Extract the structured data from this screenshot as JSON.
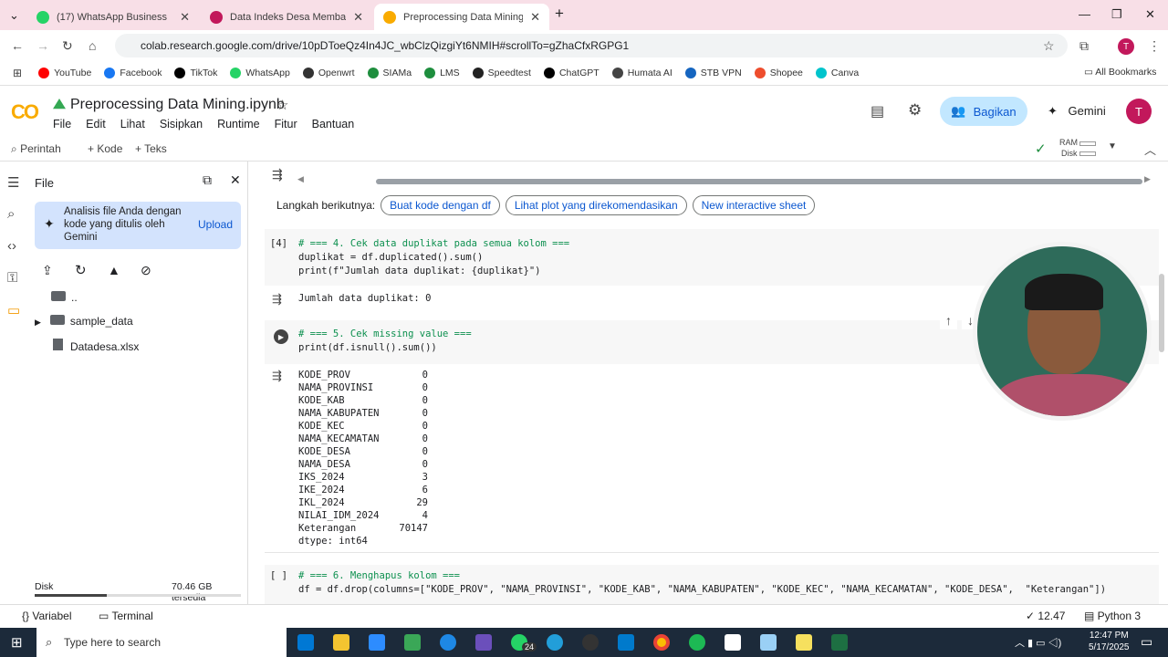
{
  "browser": {
    "tabs": [
      {
        "title": "(17) WhatsApp Business",
        "color": "#25d366"
      },
      {
        "title": "Data Indeks Desa Membangun",
        "color": "#c2185b"
      },
      {
        "title": "Preprocessing Data Mining.ipyn",
        "color": "#f9ab00"
      }
    ],
    "url": "colab.research.google.com/drive/10pDToeQz4In4JC_wbClzQizgiYt6NMIH#scrollTo=gZhaCfxRGPG1",
    "bookmarks": [
      "YouTube",
      "Facebook",
      "TikTok",
      "WhatsApp",
      "Openwrt",
      "SIAMa",
      "LMS",
      "Speedtest",
      "ChatGPT",
      "Humata AI",
      "STB VPN",
      "Shopee",
      "Canva"
    ],
    "bookmark_colors": [
      "#ff0000",
      "#1877f2",
      "#000000",
      "#25d366",
      "#333333",
      "#1e8e3e",
      "#1e8e3e",
      "#222222",
      "#000000",
      "#444444",
      "#1565c0",
      "#ee4d2d",
      "#00c4cc"
    ],
    "all_bookmarks": "All Bookmarks"
  },
  "colab": {
    "logo": "CO",
    "title": "Preprocessing Data Mining.ipynb",
    "menu": [
      "File",
      "Edit",
      "Lihat",
      "Sisipkan",
      "Runtime",
      "Fitur",
      "Bantuan"
    ],
    "share": "Bagikan",
    "gemini": "Gemini",
    "avatar": "T",
    "toolbar": {
      "command": "Perintah",
      "code": "+ Kode",
      "text": "+ Teks",
      "ram": "RAM",
      "disk": "Disk"
    }
  },
  "files": {
    "title": "File",
    "gemini_text": "Analisis file Anda dengan kode yang ditulis oleh Gemini",
    "upload": "Upload",
    "items": [
      "..",
      "sample_data",
      "Datadesa.xlsx"
    ],
    "disk_label": "Disk",
    "disk_free": "70.46 GB tersedia"
  },
  "notebook": {
    "next_steps_label": "Langkah berikutnya:",
    "chips": [
      "Buat kode dengan df",
      "Lihat plot yang direkomendasikan",
      "New interactive sheet"
    ],
    "cell4": {
      "num": "[4]",
      "line1": "# === 4. Cek data duplikat pada semua kolom ===",
      "line2": "duplikat = df.duplicated().sum()",
      "line3": "print(f\"Jumlah data duplikat: {duplikat}\")",
      "output": "Jumlah data duplikat: 0"
    },
    "cell5": {
      "line1": "# === 5. Cek missing value ===",
      "line2": "print(df.isnull().sum())",
      "rows": [
        [
          "KODE_PROV",
          "0"
        ],
        [
          "NAMA_PROVINSI",
          "0"
        ],
        [
          "KODE_KAB",
          "0"
        ],
        [
          "NAMA_KABUPATEN",
          "0"
        ],
        [
          "KODE_KEC",
          "0"
        ],
        [
          "NAMA_KECAMATAN",
          "0"
        ],
        [
          "KODE_DESA",
          "0"
        ],
        [
          "NAMA_DESA",
          "0"
        ],
        [
          "IKS_2024",
          "3"
        ],
        [
          "IKE_2024",
          "6"
        ],
        [
          "IKL_2024",
          "29"
        ],
        [
          "NILAI_IDM_2024",
          "4"
        ],
        [
          "Keterangan",
          "70147"
        ]
      ],
      "dtype": "dtype: int64"
    },
    "cell6": {
      "num": "[ ]",
      "line1": "# === 6. Menghapus kolom ===",
      "line2": "df = df.drop(columns=[\"KODE_PROV\", \"NAMA_PROVINSI\", \"KODE_KAB\", \"NAMA_KABUPATEN\", \"KODE_KEC\", \"NAMA_KECAMATAN\", \"KODE_DESA\",  \"Keterangan\"])"
    }
  },
  "statusbar": {
    "variables": "Variabel",
    "terminal": "Terminal",
    "exec": "✓ 12.47",
    "kernel": "Python 3"
  },
  "taskbar": {
    "search": "Type here to search",
    "time": "12:47 PM",
    "date": "5/17/2025",
    "badge": "24"
  }
}
